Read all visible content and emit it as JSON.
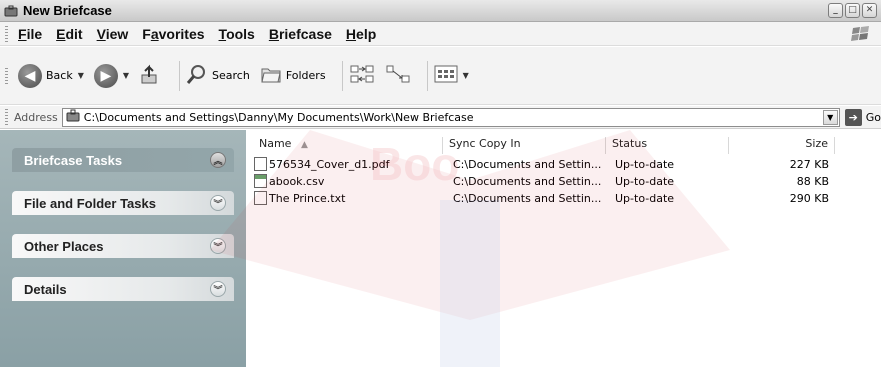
{
  "window": {
    "title": "New Briefcase"
  },
  "menu": [
    "File",
    "Edit",
    "View",
    "Favorites",
    "Tools",
    "Briefcase",
    "Help"
  ],
  "menu_underline": [
    "F",
    "E",
    "V",
    "a",
    "T",
    "B",
    "H"
  ],
  "toolbar": {
    "back_label": "Back",
    "search_label": "Search",
    "folders_label": "Folders"
  },
  "address": {
    "label": "Address",
    "path": "C:\\Documents and Settings\\Danny\\My Documents\\Work\\New Briefcase",
    "go_label": "Go"
  },
  "tasks": [
    {
      "label": "Briefcase Tasks",
      "expanded": true
    },
    {
      "label": "File and Folder Tasks",
      "expanded": false
    },
    {
      "label": "Other Places",
      "expanded": false
    },
    {
      "label": "Details",
      "expanded": false
    }
  ],
  "columns": {
    "name": "Name",
    "sync": "Sync Copy In",
    "status": "Status",
    "size": "Size"
  },
  "files": [
    {
      "name": "576534_Cover_d1.pdf",
      "sync": "C:\\Documents and Settin...",
      "status": "Up-to-date",
      "size": "227 KB",
      "icon": "pdf-file-icon"
    },
    {
      "name": "abook.csv",
      "sync": "C:\\Documents and Settin...",
      "status": "Up-to-date",
      "size": "88 KB",
      "icon": "csv-file-icon"
    },
    {
      "name": "The Prince.txt",
      "sync": "C:\\Documents and Settin...",
      "status": "Up-to-date",
      "size": "290 KB",
      "icon": "text-file-icon"
    }
  ],
  "watermark_text": "Boo",
  "colors": {
    "taskpane": "#9aabaf",
    "watermark": "#d11f2a",
    "watermark_blue": "#1f4fb0"
  }
}
